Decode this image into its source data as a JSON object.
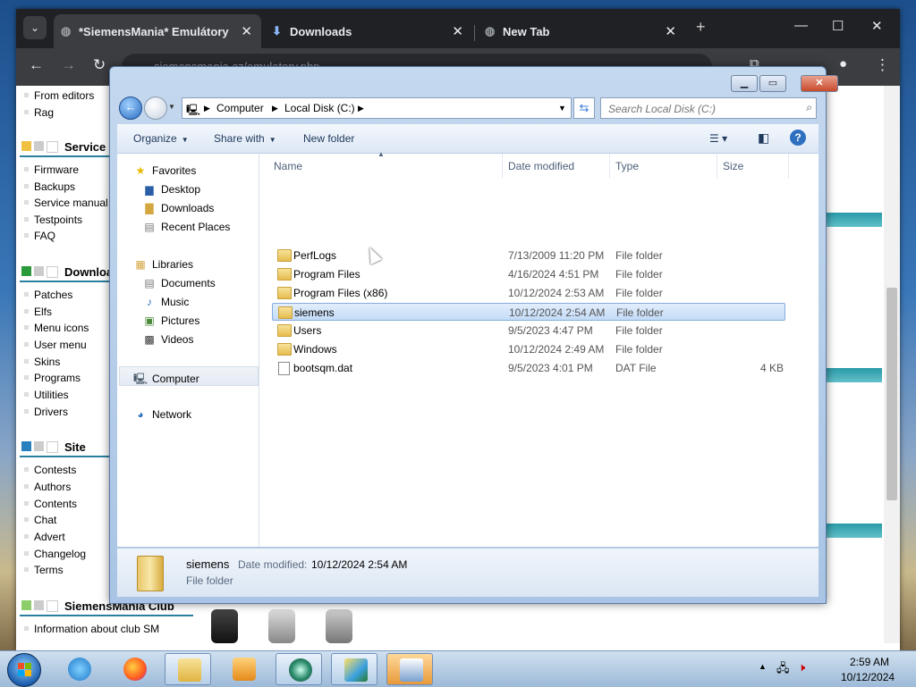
{
  "chrome": {
    "tabs": [
      {
        "label": "*SiemensMania* Emulátory"
      },
      {
        "label": "Downloads"
      },
      {
        "label": "New Tab"
      }
    ],
    "url": "siemensmania.cz/emulatory.php"
  },
  "webpage": {
    "links_top": [
      "From editors",
      "Rag"
    ],
    "sections": [
      {
        "title": "Service",
        "items": [
          "Firmware",
          "Backups",
          "Service manual",
          "Testpoints",
          "FAQ"
        ]
      },
      {
        "title": "Downloa",
        "items": [
          "Patches",
          "Elfs",
          "Menu icons",
          "User menu",
          "Skins",
          "Programs",
          "Utilities",
          "Drivers"
        ]
      },
      {
        "title": "Site",
        "items": [
          "Contests",
          "Authors",
          "Contents",
          "Chat",
          "Advert",
          "Changelog",
          "Terms"
        ]
      },
      {
        "title": "SiemensMania Club",
        "items": [
          "Information about club SM"
        ]
      }
    ]
  },
  "explorer": {
    "breadcrumb": [
      "Computer",
      "Local Disk (C:)"
    ],
    "search_placeholder": "Search Local Disk (C:)",
    "commands": {
      "organize": "Organize",
      "share_with": "Share with",
      "new_folder": "New folder"
    },
    "nav": {
      "favorites": "Favorites",
      "fav_items": [
        "Desktop",
        "Downloads",
        "Recent Places"
      ],
      "libraries": "Libraries",
      "lib_items": [
        "Documents",
        "Music",
        "Pictures",
        "Videos"
      ],
      "computer": "Computer",
      "network": "Network"
    },
    "columns": {
      "name": "Name",
      "date": "Date modified",
      "type": "Type",
      "size": "Size"
    },
    "files": [
      {
        "name": "PerfLogs",
        "date": "7/13/2009 11:20 PM",
        "type": "File folder",
        "size": ""
      },
      {
        "name": "Program Files",
        "date": "4/16/2024 4:51 PM",
        "type": "File folder",
        "size": ""
      },
      {
        "name": "Program Files (x86)",
        "date": "10/12/2024 2:53 AM",
        "type": "File folder",
        "size": ""
      },
      {
        "name": "siemens",
        "date": "10/12/2024 2:54 AM",
        "type": "File folder",
        "size": ""
      },
      {
        "name": "Users",
        "date": "9/5/2023 4:47 PM",
        "type": "File folder",
        "size": ""
      },
      {
        "name": "Windows",
        "date": "10/12/2024 2:49 AM",
        "type": "File folder",
        "size": ""
      },
      {
        "name": "bootsqm.dat",
        "date": "9/5/2023 4:01 PM",
        "type": "DAT File",
        "size": "4 KB"
      }
    ],
    "details": {
      "name": "siemens",
      "date_label": "Date modified:",
      "date": "10/12/2024 2:54 AM",
      "type": "File folder"
    }
  },
  "taskbar": {
    "time": "2:59 AM",
    "date": "10/12/2024"
  }
}
